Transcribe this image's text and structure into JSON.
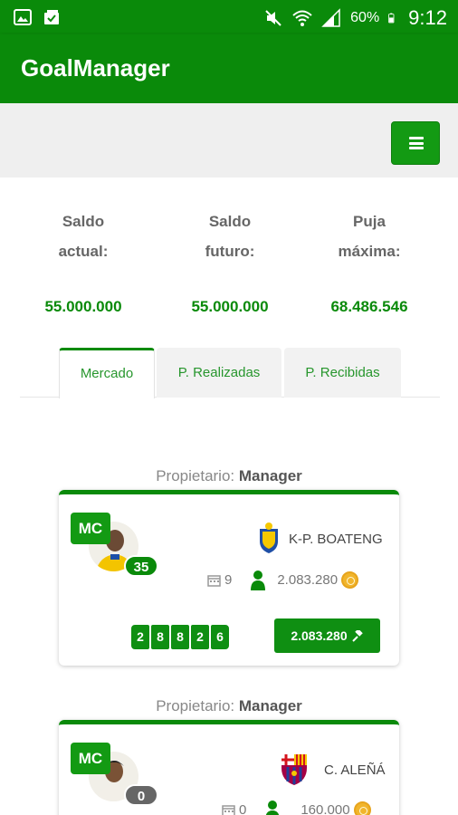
{
  "status_bar": {
    "battery": "60%",
    "time": "9:12"
  },
  "app": {
    "title": "GoalManager"
  },
  "stats": [
    {
      "label_1": "Saldo",
      "label_2": "actual:",
      "value": "55.000.000"
    },
    {
      "label_1": "Saldo",
      "label_2": "futuro:",
      "value": "55.000.000"
    },
    {
      "label_1": "Puja",
      "label_2": "máxima:",
      "value": "68.486.546"
    }
  ],
  "tabs": [
    {
      "label": "Mercado",
      "active": true
    },
    {
      "label": "P. Realizadas",
      "active": false
    },
    {
      "label": "P. Recibidas",
      "active": false
    }
  ],
  "players": [
    {
      "owner_label": "Propietario:",
      "owner": "Manager",
      "position": "MC",
      "score": "35",
      "score_color": "#0a8a0a",
      "name": "K-P. BOATENG",
      "matches": "9",
      "value": "2.083.280",
      "points": [
        "2",
        "8",
        "8",
        "2",
        "6"
      ],
      "bid_label": "2.083.280"
    },
    {
      "owner_label": "Propietario:",
      "owner": "Manager",
      "position": "MC",
      "score": "0",
      "score_color": "#666666",
      "name": "C. ALEÑÁ",
      "matches": "0",
      "value": "160.000"
    }
  ],
  "colors": {
    "primary": "#0a8a0a",
    "button": "#139a13",
    "coin": "#f1b52c"
  },
  "icons": [
    "image-icon",
    "gallery-check-icon",
    "mute-icon",
    "wifi-icon",
    "signal-icon",
    "battery-icon",
    "menu-icon",
    "calendar-icon",
    "user-icon",
    "coin-icon",
    "gavel-icon"
  ]
}
